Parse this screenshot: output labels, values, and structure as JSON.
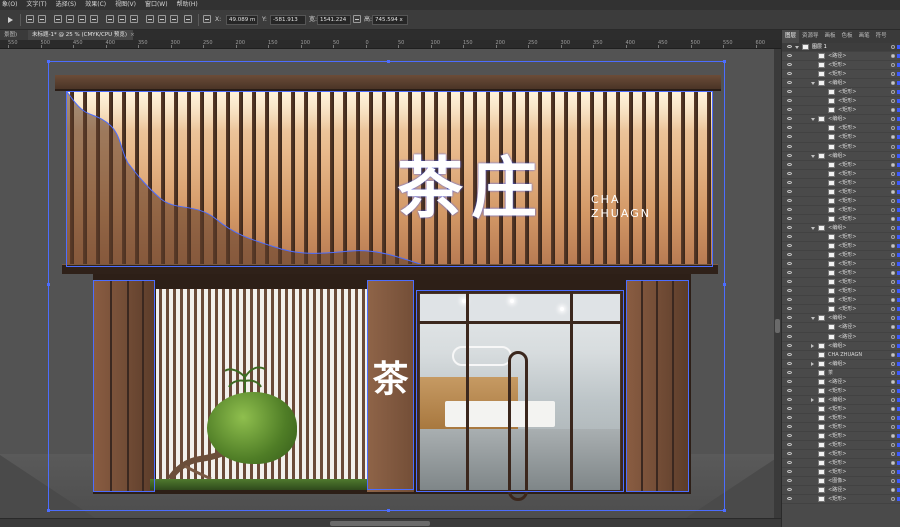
{
  "menu": [
    "象(O)",
    "文字(T)",
    "选择(S)",
    "效果(C)",
    "视图(V)",
    "窗口(W)",
    "帮助(H)"
  ],
  "control": {
    "x_value": "49.089 m",
    "y_value": "-581.913",
    "width_value": "1541.224",
    "height_value": "745.594 x",
    "x_label": "X:",
    "y_label": "Y:",
    "w_label": "宽:",
    "h_label": "高:"
  },
  "tabs": [
    {
      "label": "景图)"
    },
    {
      "label": "未标题-1* @ 25 % (CMYK/CPU 预览)",
      "close": "×"
    }
  ],
  "ruler_marks": [
    "550",
    "500",
    "450",
    "400",
    "350",
    "300",
    "250",
    "200",
    "150",
    "100",
    "50",
    "0",
    "50",
    "100",
    "150",
    "200",
    "250",
    "300",
    "350",
    "400",
    "450",
    "500",
    "550",
    "600"
  ],
  "artwork": {
    "sign_main": "茶庄",
    "sign_sub_line1": "CHA",
    "sign_sub_line2": "ZHUAGN",
    "pillar_char": "茶"
  },
  "panel": {
    "tabs": [
      "图层",
      "资源导",
      "画板",
      "色板",
      "画笔",
      "符号"
    ],
    "layers": [
      {
        "name": "图层 1",
        "type": "main"
      },
      {
        "name": "<路径>",
        "type": "item"
      },
      {
        "name": "<矩形>",
        "type": "item"
      },
      {
        "name": "<矩形>",
        "type": "item"
      },
      {
        "name": "<编组>",
        "type": "group"
      },
      {
        "name": "<矩形>",
        "type": "sub"
      },
      {
        "name": "<矩形>",
        "type": "sub"
      },
      {
        "name": "<矩形>",
        "type": "sub"
      },
      {
        "name": "<编组>",
        "type": "group"
      },
      {
        "name": "<矩形>",
        "type": "sub"
      },
      {
        "name": "<矩形>",
        "type": "sub"
      },
      {
        "name": "<矩形>",
        "type": "sub"
      },
      {
        "name": "<编组>",
        "type": "group"
      },
      {
        "name": "<矩形>",
        "type": "sub"
      },
      {
        "name": "<矩形>",
        "type": "sub"
      },
      {
        "name": "<矩形>",
        "type": "sub"
      },
      {
        "name": "<矩形>",
        "type": "sub"
      },
      {
        "name": "<矩形>",
        "type": "sub"
      },
      {
        "name": "<矩形>",
        "type": "sub"
      },
      {
        "name": "<矩形>",
        "type": "sub"
      },
      {
        "name": "<编组>",
        "type": "group"
      },
      {
        "name": "<矩形>",
        "type": "sub"
      },
      {
        "name": "<矩形>",
        "type": "sub"
      },
      {
        "name": "<矩形>",
        "type": "sub"
      },
      {
        "name": "<矩形>",
        "type": "sub"
      },
      {
        "name": "<矩形>",
        "type": "sub"
      },
      {
        "name": "<矩形>",
        "type": "sub"
      },
      {
        "name": "<矩形>",
        "type": "sub"
      },
      {
        "name": "<矩形>",
        "type": "sub"
      },
      {
        "name": "<矩形>",
        "type": "sub"
      },
      {
        "name": "<编组>",
        "type": "group"
      },
      {
        "name": "<路径>",
        "type": "sub"
      },
      {
        "name": "<路径>",
        "type": "sub"
      },
      {
        "name": "<编组>",
        "type": "group"
      },
      {
        "name": "CHA ZHUAGN",
        "type": "item"
      },
      {
        "name": "<编组>",
        "type": "group"
      },
      {
        "name": "茶",
        "type": "item"
      },
      {
        "name": "<路径>",
        "type": "item"
      },
      {
        "name": "<矩形>",
        "type": "item"
      },
      {
        "name": "<编组>",
        "type": "group"
      },
      {
        "name": "<矩形>",
        "type": "item"
      },
      {
        "name": "<矩形>",
        "type": "item"
      },
      {
        "name": "<矩形>",
        "type": "item"
      },
      {
        "name": "<矩形>",
        "type": "item"
      },
      {
        "name": "<矩形>",
        "type": "item"
      },
      {
        "name": "<矩形>",
        "type": "item"
      },
      {
        "name": "<矩形>",
        "type": "item"
      },
      {
        "name": "<矩形>",
        "type": "item"
      },
      {
        "name": "<图像>",
        "type": "item"
      },
      {
        "name": "<路径>",
        "type": "item"
      },
      {
        "name": "<矩形>",
        "type": "item"
      }
    ]
  }
}
